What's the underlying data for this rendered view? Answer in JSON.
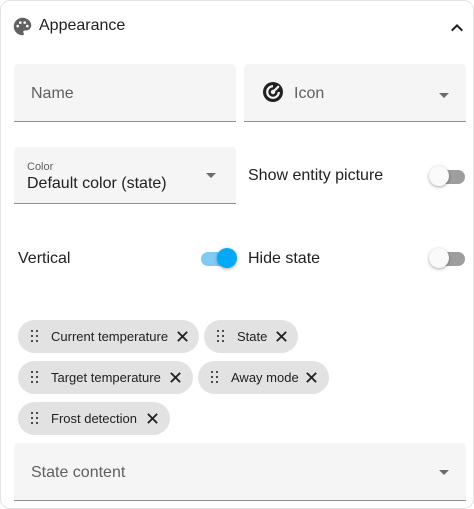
{
  "header": {
    "title": "Appearance",
    "palette_icon": "palette-icon",
    "collapse_icon": "chevron-up-icon"
  },
  "fields": {
    "name": {
      "label": "Name"
    },
    "icon": {
      "label": "Icon",
      "icon": "gauge-icon"
    },
    "color": {
      "label": "Color",
      "value": "Default color (state)"
    },
    "state_content": {
      "label": "State content"
    }
  },
  "toggles": {
    "show_entity_picture": {
      "label": "Show entity picture",
      "on": false
    },
    "vertical": {
      "label": "Vertical",
      "on": true
    },
    "hide_state": {
      "label": "Hide state",
      "on": false
    }
  },
  "chips": [
    {
      "label": "Current temperature"
    },
    {
      "label": "State"
    },
    {
      "label": "Target temperature"
    },
    {
      "label": "Away mode"
    },
    {
      "label": "Frost detection"
    }
  ],
  "colors": {
    "accent": "#03a9f4",
    "accent_track": "#7fcbf5",
    "field_bg": "#f5f5f5",
    "chip_bg": "#e2e2e2"
  }
}
